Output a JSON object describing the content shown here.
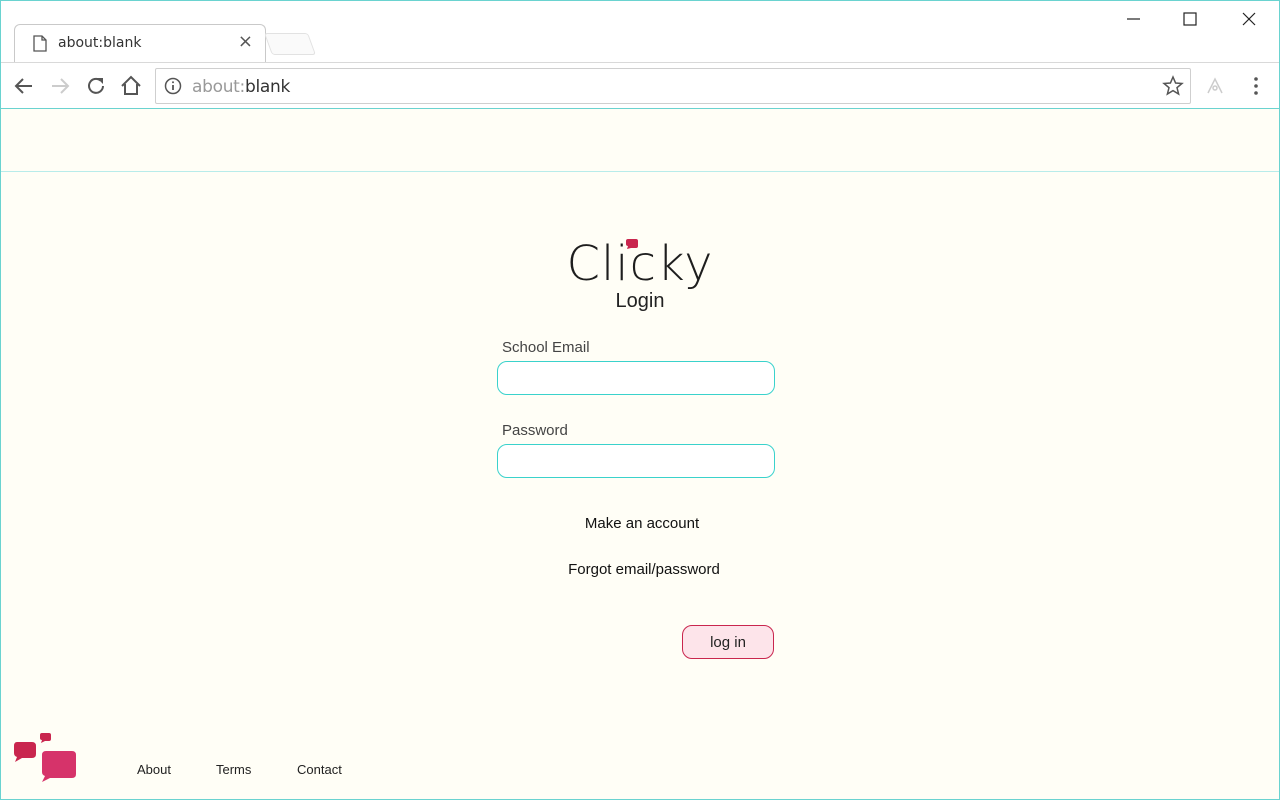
{
  "browser": {
    "tab_title": "about:blank",
    "tab_close": "×",
    "url_prefix": "about:",
    "url_main": "blank"
  },
  "logo": {
    "word": "Clicky",
    "brand_color": "#c9264e"
  },
  "login": {
    "title": "Login",
    "email_label": "School Email",
    "email_value": "",
    "password_label": "Password",
    "password_value": "",
    "make_account_link": "Make an account",
    "forgot_link": "Forgot email/password",
    "login_button": "log in"
  },
  "footer": {
    "links": [
      "About",
      "Terms",
      "Contact"
    ]
  },
  "colors": {
    "accent": "#3ad2cc",
    "brand": "#c9264e",
    "button_bg": "#fde4ea",
    "page_bg": "#fffef6"
  },
  "icons": [
    "document-icon",
    "close-icon",
    "minimize-icon",
    "maximize-icon",
    "window-close-icon",
    "back-icon",
    "forward-icon",
    "reload-icon",
    "home-icon",
    "info-icon",
    "star-icon",
    "extension-icon",
    "menu-icon",
    "logo-dot-icon",
    "footer-logo-icon"
  ]
}
